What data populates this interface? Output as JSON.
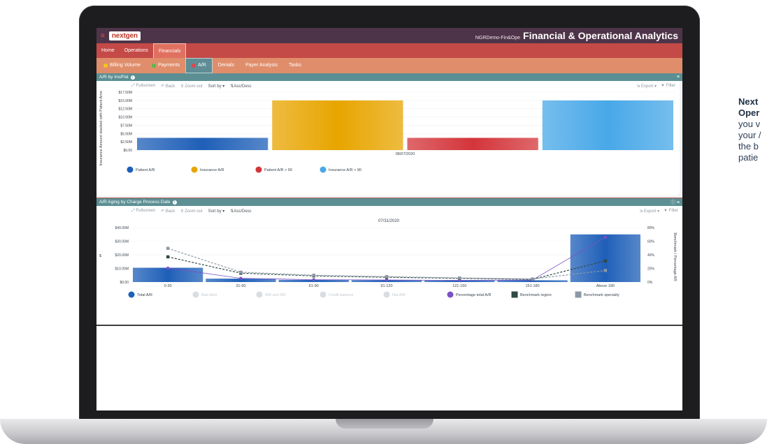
{
  "header": {
    "brand": "nextgen",
    "user": "NGRDemo-Fin&Ope",
    "title": "Financial & Operational Analytics"
  },
  "nav_primary": [
    {
      "label": "Home",
      "active": false
    },
    {
      "label": "Operations",
      "active": false
    },
    {
      "label": "Financials",
      "active": true
    }
  ],
  "nav_secondary": [
    {
      "label": "Billing Volume",
      "icon": "yellow-dot-icon",
      "active": false
    },
    {
      "label": "Payments",
      "icon": "green-dot-icon",
      "active": false
    },
    {
      "label": "A/R",
      "icon": "red-dot-icon",
      "active": true
    },
    {
      "label": "Denials",
      "active": false
    },
    {
      "label": "Payer Analysis",
      "active": false
    },
    {
      "label": "Tasks",
      "active": false
    }
  ],
  "toolbar": {
    "fullscreen": "Fullscreen",
    "back": "Back",
    "zoom_out": "Zoom out",
    "sort_by": "Sort by ▾",
    "asc_desc": "Asc/Desc",
    "export": "Export ▾",
    "filter": "Filter"
  },
  "side_text": {
    "line1": "Next",
    "line2": "Oper",
    "line3": "you v",
    "line4": "your /",
    "line5": "the b",
    "line6": "patie"
  },
  "chart_data": [
    {
      "type": "bar",
      "title": "A/R by Ins/Pat",
      "ylabel": "Insurance Amount stacked with Patient Amount",
      "categories": [
        "08/07/2020"
      ],
      "yticks": [
        "$17.50M",
        "$15.00M",
        "$12.50M",
        "$10.00M",
        "$7.50M",
        "$5.00M",
        "$2.50M",
        "$0.00"
      ],
      "ylim": [
        0,
        17.5
      ],
      "series": [
        {
          "name": "Patient A/R",
          "values": [
            3.7
          ],
          "color": "#1f5fb8"
        },
        {
          "name": "Insurance A/R",
          "values": [
            15.0
          ],
          "color": "#e8a500"
        },
        {
          "name": "Patient A/R > 90",
          "values": [
            3.7
          ],
          "color": "#d3353a"
        },
        {
          "name": "Insurance A/R > 90",
          "values": [
            15.0
          ],
          "color": "#48a8e8"
        }
      ]
    },
    {
      "type": "bar",
      "title": "A/R Aging by Charge Process Date",
      "subtitle": "07/31/2020",
      "ylabel": "$",
      "y2label": "Benchmark / Percentage AR",
      "categories": [
        "0-30",
        "31-60",
        "61-90",
        "91-120",
        "121-150",
        "151-180",
        "Above 180"
      ],
      "yticks": [
        "$40.00M",
        "$30.00M",
        "$20.00M",
        "$10.00M",
        "$0.00"
      ],
      "y2ticks": [
        "80%",
        "60%",
        "40%",
        "20%",
        "0%"
      ],
      "ylim": [
        0,
        40
      ],
      "y2lim": [
        0,
        80
      ],
      "bars": {
        "name": "Total A/R",
        "values": [
          10.5,
          2.5,
          1.6,
          1.4,
          1.2,
          1.3,
          35.0
        ],
        "color": "#1f5fb8"
      },
      "lines": [
        {
          "name": "Percentage total A/R",
          "values": [
            20.5,
            5.5,
            3.5,
            3.0,
            2.5,
            3.0,
            66.0
          ],
          "color": "#7a52c7"
        },
        {
          "name": "Benchmark region",
          "values": [
            37.0,
            13.0,
            9.0,
            7.0,
            5.5,
            4.0,
            31.0
          ],
          "color": "#2f4a44"
        },
        {
          "name": "Benchmark specialty",
          "values": [
            49.5,
            14.5,
            10.0,
            8.0,
            6.0,
            4.5,
            17.0
          ],
          "color": "#8d98a6"
        }
      ],
      "legend": [
        {
          "name": "Total A/R",
          "color": "#1f5fb8",
          "shape": "circle",
          "enabled": true
        },
        {
          "name": "Bad debt",
          "color": "#d9dde2",
          "shape": "circle",
          "enabled": false
        },
        {
          "name": "A/R excl BD",
          "color": "#d9dde2",
          "shape": "circle",
          "enabled": false
        },
        {
          "name": "Credit balance",
          "color": "#d9dde2",
          "shape": "circle",
          "enabled": false
        },
        {
          "name": "Net A/R",
          "color": "#d9dde2",
          "shape": "circle",
          "enabled": false
        },
        {
          "name": "Percentage total A/R",
          "color": "#7a52c7",
          "shape": "circle",
          "enabled": true
        },
        {
          "name": "Benchmark region",
          "color": "#2f4a44",
          "shape": "square",
          "enabled": true
        },
        {
          "name": "Benchmark specialty",
          "color": "#8d98a6",
          "shape": "square",
          "enabled": true
        }
      ]
    }
  ]
}
